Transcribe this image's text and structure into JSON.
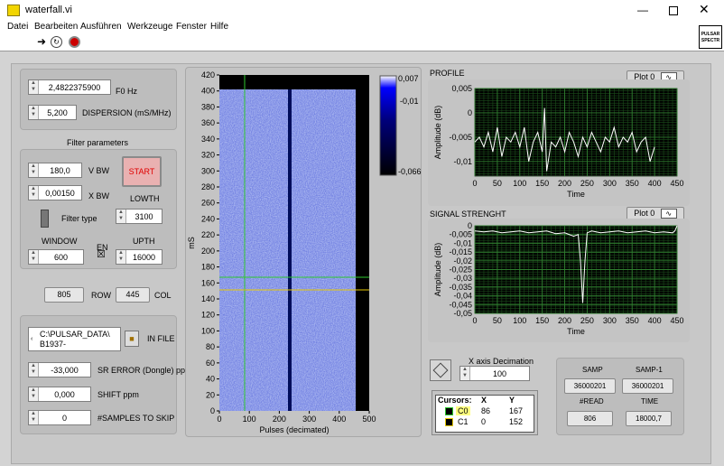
{
  "window": {
    "title": "waterfall.vi"
  },
  "menu": [
    "Datei",
    "Bearbeiten",
    "Ausführen",
    "Werkzeuge",
    "Fenster",
    "Hilfe"
  ],
  "corner_icon": [
    "PULSAR",
    "SPECTR"
  ],
  "controls": {
    "f0": {
      "value": "2,4822375900",
      "label": "F0 Hz"
    },
    "dispersion": {
      "value": "5,200",
      "label": "DISPERSION (mS/MHz)"
    },
    "filter_title": "Filter parameters",
    "vbw": {
      "value": "180,0",
      "label": "V BW"
    },
    "xbw": {
      "value": "0,00150",
      "label": "X BW"
    },
    "start_label": "START",
    "lowth": {
      "label": "LOWTH",
      "value": "3100"
    },
    "filter_type_label": "Filter type",
    "window": {
      "label": "WINDOW",
      "value": "600"
    },
    "en_label": "EN",
    "en_mark": "☒",
    "upth": {
      "label": "UPTH",
      "value": "16000"
    },
    "row": {
      "value": "805",
      "label": "ROW"
    },
    "col": {
      "value": "445",
      "label": "COL"
    },
    "in_file": {
      "value_line1": "C:\\PULSAR_DATA\\",
      "value_line2": "B1937-",
      "label": "IN FILE"
    },
    "sr_error": {
      "value": "-33,000",
      "label": "SR ERROR (Dongle) ppm"
    },
    "shift": {
      "value": "0,000",
      "label": "SHIFT ppm"
    },
    "samples_skip": {
      "value": "0",
      "label": "#SAMPLES TO SKIP"
    }
  },
  "waterfall": {
    "ylabel": "mS",
    "xlabel": "Pulses (decimated)",
    "yticks": [
      "0",
      "20",
      "40",
      "60",
      "80",
      "100",
      "120",
      "140",
      "160",
      "180",
      "200",
      "220",
      "240",
      "260",
      "280",
      "300",
      "320",
      "340",
      "360",
      "380",
      "400",
      "420"
    ],
    "xticks": [
      "0",
      "100",
      "200",
      "300",
      "400",
      "500"
    ],
    "colorbar_ticks": [
      "0,007",
      "-0,01",
      "-0,066"
    ]
  },
  "profile": {
    "title": "PROFILE",
    "plot_legend": "Plot 0"
  },
  "signal": {
    "title": "SIGNAL STRENGHT",
    "plot_legend": "Plot 0"
  },
  "xdec": {
    "label": "X axis Decimation",
    "value": "100"
  },
  "cursors": {
    "headers": [
      "Cursors:",
      "X",
      "Y"
    ],
    "rows": [
      {
        "name": "C0",
        "x": "86",
        "y": "167"
      },
      {
        "name": "C1",
        "x": "0",
        "y": "152"
      }
    ]
  },
  "indicators": {
    "samp": {
      "label": "SAMP",
      "value": "36000201"
    },
    "samp1": {
      "label": "SAMP-1",
      "value": "36000201"
    },
    "read": {
      "label": "#READ",
      "value": "806"
    },
    "time": {
      "label": "TIME",
      "value": "18000,7"
    }
  },
  "chart_data": [
    {
      "type": "line",
      "title": "PROFILE",
      "xlabel": "Time",
      "ylabel": "Amplitude (dB)",
      "xlim": [
        0,
        450
      ],
      "ylim": [
        -0.013,
        0.005
      ],
      "xticks": [
        0,
        50,
        100,
        150,
        200,
        250,
        300,
        350,
        400,
        450
      ],
      "yticks": [
        0.005,
        0,
        -0.005,
        -0.01
      ],
      "ytick_labels": [
        "0,005",
        "0",
        "-0,005",
        "-0,01"
      ],
      "grid": true,
      "series": [
        {
          "x": [
            0,
            10,
            20,
            30,
            40,
            50,
            60,
            70,
            80,
            90,
            100,
            110,
            120,
            130,
            140,
            150,
            155,
            160,
            170,
            180,
            190,
            200,
            210,
            220,
            230,
            240,
            250,
            260,
            270,
            280,
            290,
            300,
            310,
            320,
            330,
            340,
            350,
            360,
            370,
            380,
            390,
            400
          ],
          "values": [
            -0.006,
            -0.005,
            -0.007,
            -0.004,
            -0.008,
            -0.003,
            -0.009,
            -0.005,
            -0.006,
            -0.004,
            -0.007,
            -0.003,
            -0.01,
            -0.006,
            -0.004,
            -0.008,
            0.001,
            -0.012,
            -0.006,
            -0.007,
            -0.005,
            -0.008,
            -0.004,
            -0.006,
            -0.009,
            -0.005,
            -0.007,
            -0.004,
            -0.006,
            -0.008,
            -0.005,
            -0.006,
            -0.003,
            -0.007,
            -0.005,
            -0.006,
            -0.004,
            -0.008,
            -0.006,
            -0.005,
            -0.01,
            -0.007
          ]
        }
      ]
    },
    {
      "type": "line",
      "title": "SIGNAL STRENGHT",
      "xlabel": "Time",
      "ylabel": "Amplitude (dB)",
      "xlim": [
        0,
        450
      ],
      "ylim": [
        -0.05,
        0
      ],
      "xticks": [
        0,
        50,
        100,
        150,
        200,
        250,
        300,
        350,
        400,
        450
      ],
      "yticks": [
        0,
        -0.005,
        -0.01,
        -0.015,
        -0.02,
        -0.025,
        -0.03,
        -0.035,
        -0.04,
        -0.045,
        -0.05
      ],
      "ytick_labels": [
        "0",
        "-0,005",
        "-0,01",
        "-0,015",
        "-0,02",
        "-0,025",
        "-0,03",
        "-0,035",
        "-0,04",
        "-0,045",
        "-0,05"
      ],
      "grid": true,
      "series": [
        {
          "x": [
            0,
            20,
            40,
            60,
            80,
            100,
            120,
            140,
            160,
            180,
            200,
            220,
            230,
            235,
            240,
            245,
            250,
            260,
            280,
            300,
            320,
            340,
            360,
            380,
            400,
            420,
            440,
            445,
            450
          ],
          "values": [
            -0.003,
            -0.0035,
            -0.003,
            -0.004,
            -0.0035,
            -0.003,
            -0.004,
            -0.0035,
            -0.003,
            -0.0045,
            -0.004,
            -0.006,
            -0.005,
            -0.02,
            -0.044,
            -0.02,
            -0.004,
            -0.003,
            -0.004,
            -0.0035,
            -0.003,
            -0.004,
            -0.0035,
            -0.003,
            -0.004,
            -0.0035,
            -0.004,
            -0.003,
            0
          ]
        }
      ]
    }
  ]
}
